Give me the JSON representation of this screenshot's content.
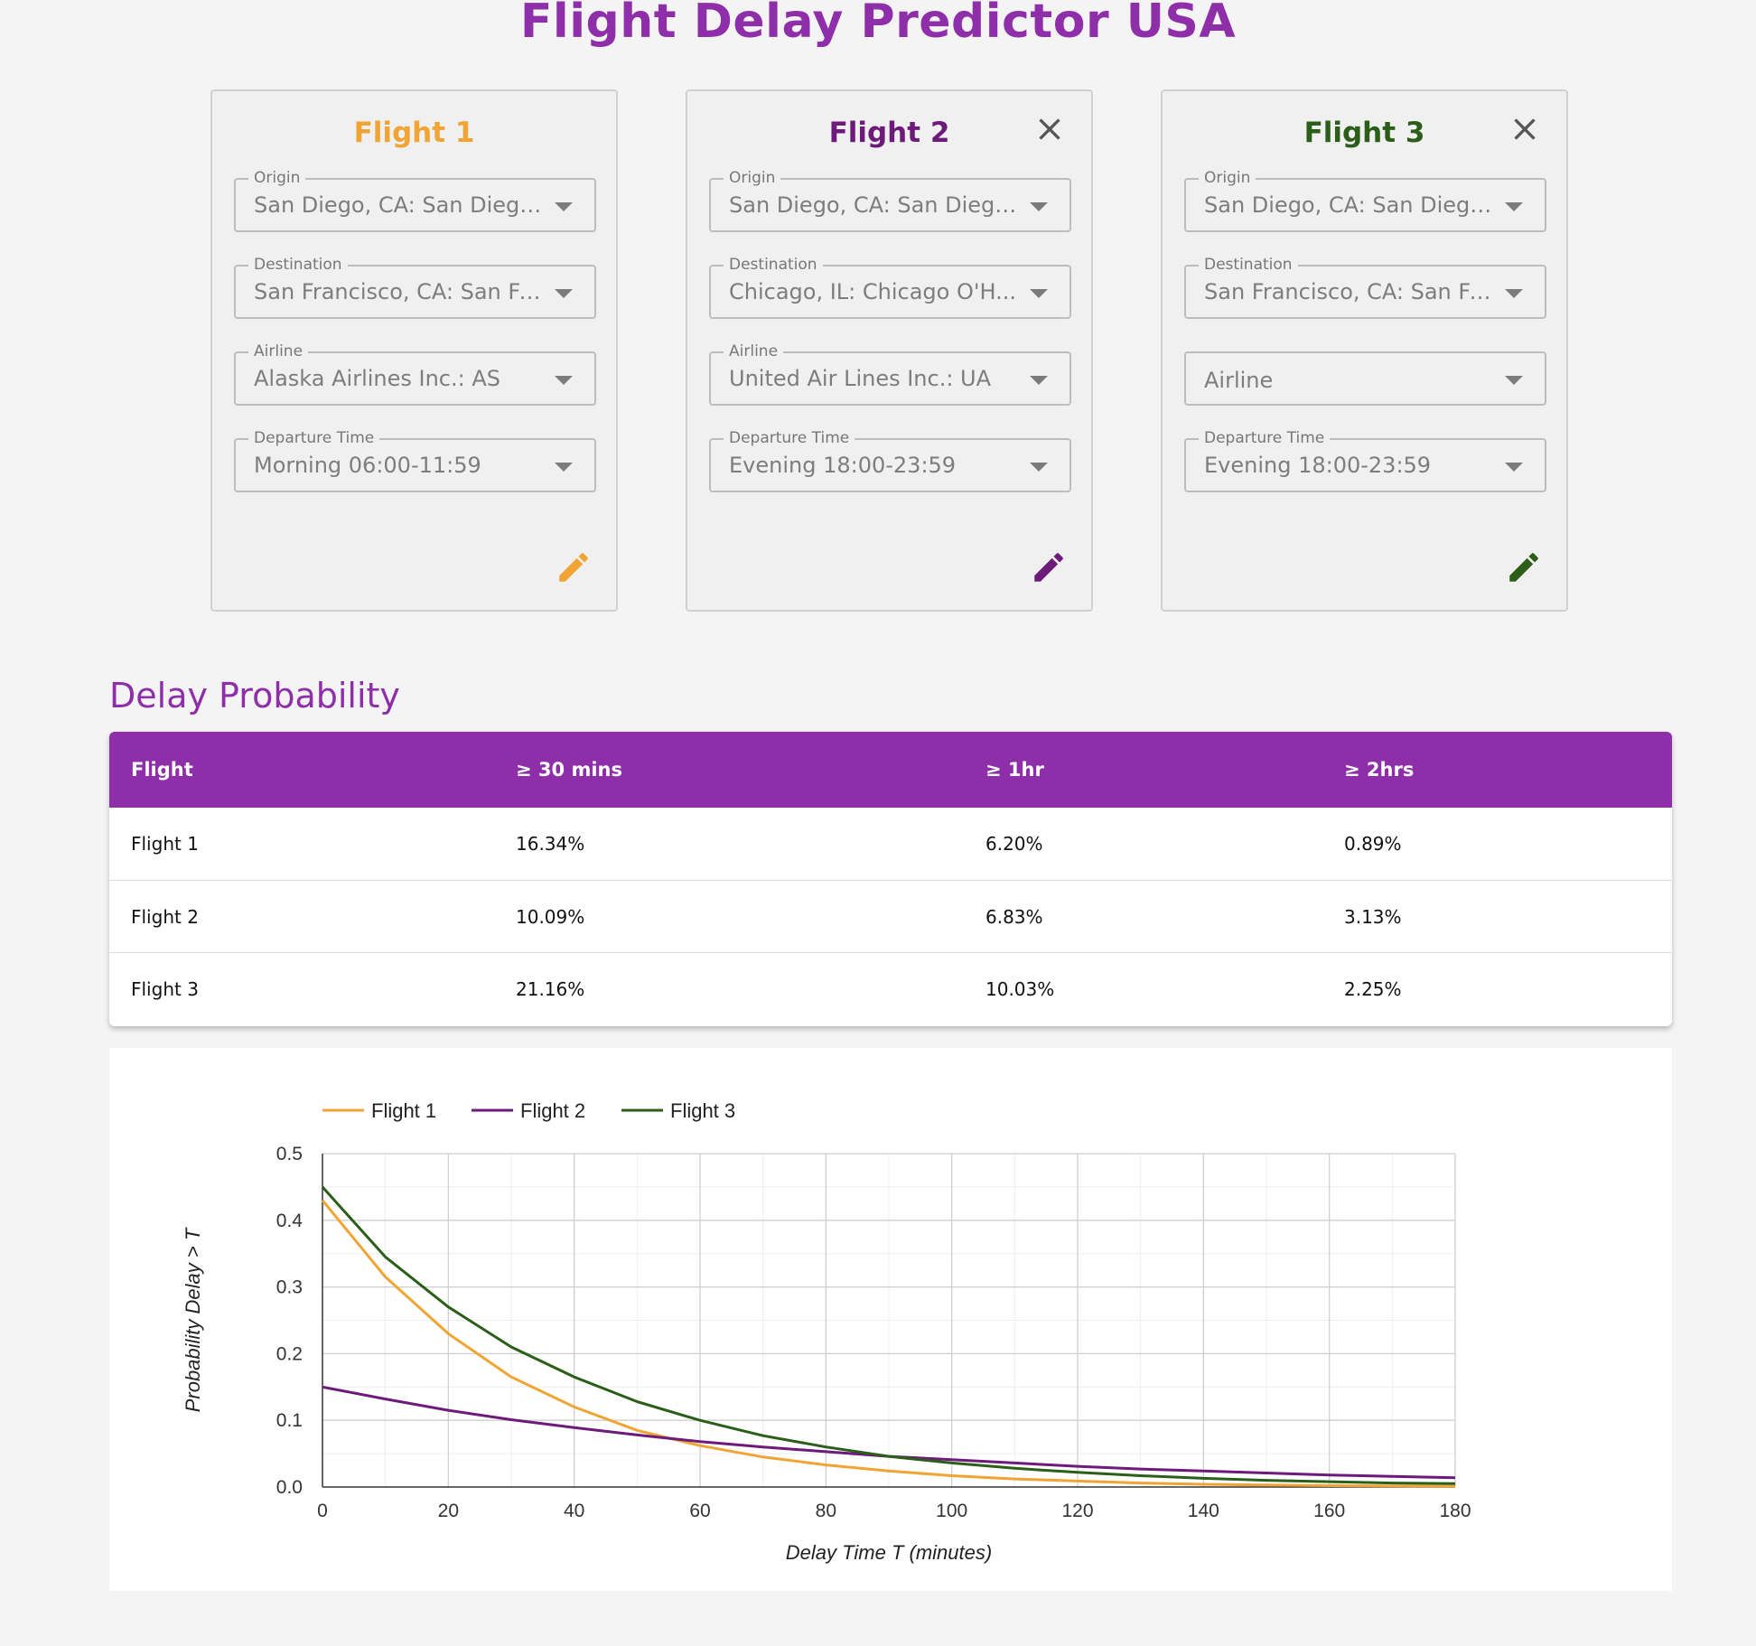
{
  "page": {
    "title": "Flight Delay Predictor USA"
  },
  "colors": {
    "accent": "#8e2fa9",
    "flight1": "#f0a433",
    "flight2": "#6d1a7a",
    "flight3": "#2b5e18"
  },
  "cards": [
    {
      "title": "Flight 1",
      "closable": false,
      "fields": [
        {
          "label": "Origin",
          "value": "San Diego, CA: San Diego..."
        },
        {
          "label": "Destination",
          "value": "San Francisco, CA: San Fr..."
        },
        {
          "label": "Airline",
          "value": "Alaska Airlines Inc.: AS"
        },
        {
          "label": "Departure Time",
          "value": "Morning 06:00-11:59"
        }
      ]
    },
    {
      "title": "Flight 2",
      "closable": true,
      "fields": [
        {
          "label": "Origin",
          "value": "San Diego, CA: San Diego..."
        },
        {
          "label": "Destination",
          "value": "Chicago, IL: Chicago O'H..."
        },
        {
          "label": "Airline",
          "value": "United Air Lines Inc.: UA"
        },
        {
          "label": "Departure Time",
          "value": "Evening 18:00-23:59"
        }
      ]
    },
    {
      "title": "Flight 3",
      "closable": true,
      "fields": [
        {
          "label": "Origin",
          "value": "San Diego, CA: San Diego..."
        },
        {
          "label": "Destination",
          "value": "San Francisco, CA: San Fr..."
        },
        {
          "label": "",
          "value": "Airline"
        },
        {
          "label": "Departure Time",
          "value": "Evening 18:00-23:59"
        }
      ]
    }
  ],
  "delay_section": {
    "title": "Delay Probability",
    "headers": [
      "Flight",
      "≥ 30 mins",
      "≥ 1hr",
      "≥ 2hrs"
    ],
    "rows": [
      [
        "Flight 1",
        "16.34%",
        "6.20%",
        "0.89%"
      ],
      [
        "Flight 2",
        "10.09%",
        "6.83%",
        "3.13%"
      ],
      [
        "Flight 3",
        "21.16%",
        "10.03%",
        "2.25%"
      ]
    ]
  },
  "chart_data": {
    "type": "line",
    "title": "",
    "xlabel": "Delay Time T (minutes)",
    "ylabel": "Probability Delay > T",
    "xlim": [
      0,
      180
    ],
    "ylim": [
      0,
      0.5
    ],
    "x_ticks": [
      0,
      20,
      40,
      60,
      80,
      100,
      120,
      140,
      160,
      180
    ],
    "y_ticks": [
      0.0,
      0.1,
      0.2,
      0.3,
      0.4,
      0.5
    ],
    "y_tick_labels": [
      "0.0",
      "0.1",
      "0.2",
      "0.3",
      "0.4",
      "0.5"
    ],
    "grid": true,
    "legend_position": "top-left",
    "x": [
      0,
      10,
      20,
      30,
      40,
      50,
      60,
      70,
      80,
      90,
      100,
      110,
      120,
      130,
      140,
      150,
      160,
      170,
      180
    ],
    "series": [
      {
        "name": "Flight 1",
        "color": "#f0a433",
        "values": [
          0.43,
          0.315,
          0.23,
          0.165,
          0.12,
          0.085,
          0.062,
          0.045,
          0.033,
          0.024,
          0.017,
          0.012,
          0.009,
          0.006,
          0.004,
          0.003,
          0.002,
          0.0015,
          0.001
        ]
      },
      {
        "name": "Flight 2",
        "color": "#6d1a7a",
        "values": [
          0.15,
          0.132,
          0.115,
          0.101,
          0.089,
          0.078,
          0.068,
          0.06,
          0.053,
          0.046,
          0.041,
          0.036,
          0.031,
          0.027,
          0.024,
          0.021,
          0.018,
          0.016,
          0.014
        ]
      },
      {
        "name": "Flight 3",
        "color": "#2b5e18",
        "values": [
          0.45,
          0.345,
          0.27,
          0.21,
          0.165,
          0.128,
          0.1,
          0.077,
          0.06,
          0.046,
          0.036,
          0.028,
          0.022,
          0.017,
          0.013,
          0.01,
          0.008,
          0.006,
          0.005
        ]
      }
    ]
  }
}
